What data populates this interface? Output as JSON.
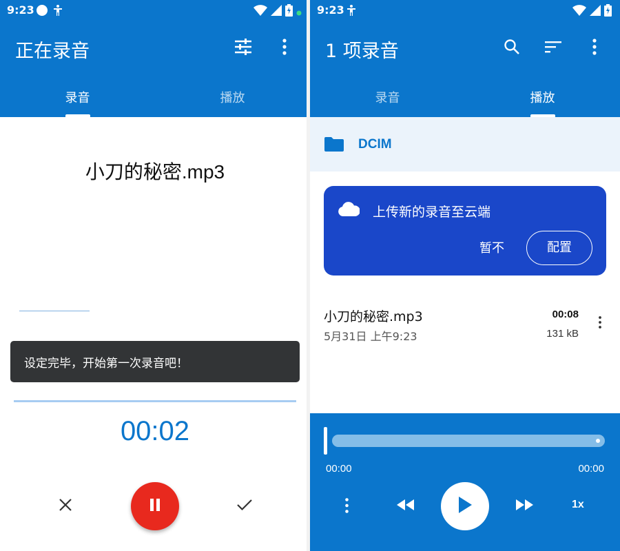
{
  "left": {
    "status": {
      "time": "9:23"
    },
    "app_bar": {
      "title": "正在录音"
    },
    "tabs": [
      {
        "label": "录音",
        "active": true
      },
      {
        "label": "播放",
        "active": false
      }
    ],
    "recording": {
      "filename": "小刀的秘密.mp3",
      "elapsed": "00:02"
    },
    "toast": {
      "message": "设定完毕，开始第一次录音吧！"
    },
    "icons": {
      "settings": "tune-sliders-icon",
      "more": "more-vert-icon",
      "cancel": "close-icon",
      "pause": "pause-icon",
      "done": "check-icon"
    }
  },
  "right": {
    "status": {
      "time": "9:23"
    },
    "app_bar": {
      "title": "1 项录音"
    },
    "tabs": [
      {
        "label": "录音",
        "active": false
      },
      {
        "label": "播放",
        "active": true
      }
    ],
    "folder": {
      "name": "DCIM"
    },
    "cloud_card": {
      "message": "上传新的录音至云端",
      "later_label": "暂不",
      "config_label": "配置"
    },
    "recordings": [
      {
        "name": "小刀的秘密.mp3",
        "date": "5月31日 上午9:23",
        "duration": "00:08",
        "size": "131 kB"
      }
    ],
    "player": {
      "position": "00:00",
      "duration": "00:00",
      "speed": "1x",
      "progress": 0
    },
    "icons": {
      "search": "search-icon",
      "sort": "sort-icon",
      "more": "more-vert-icon",
      "folder": "folder-icon",
      "cloud": "cloud-icon",
      "rewind": "rewind-icon",
      "play": "play-icon",
      "fast_forward": "fast-forward-icon"
    }
  },
  "colors": {
    "primary": "#0b76cc",
    "record_red": "#e8291e",
    "cloud_card": "#1a47c9",
    "toast_bg": "#323436",
    "folder_bar": "#ebf3fb"
  }
}
